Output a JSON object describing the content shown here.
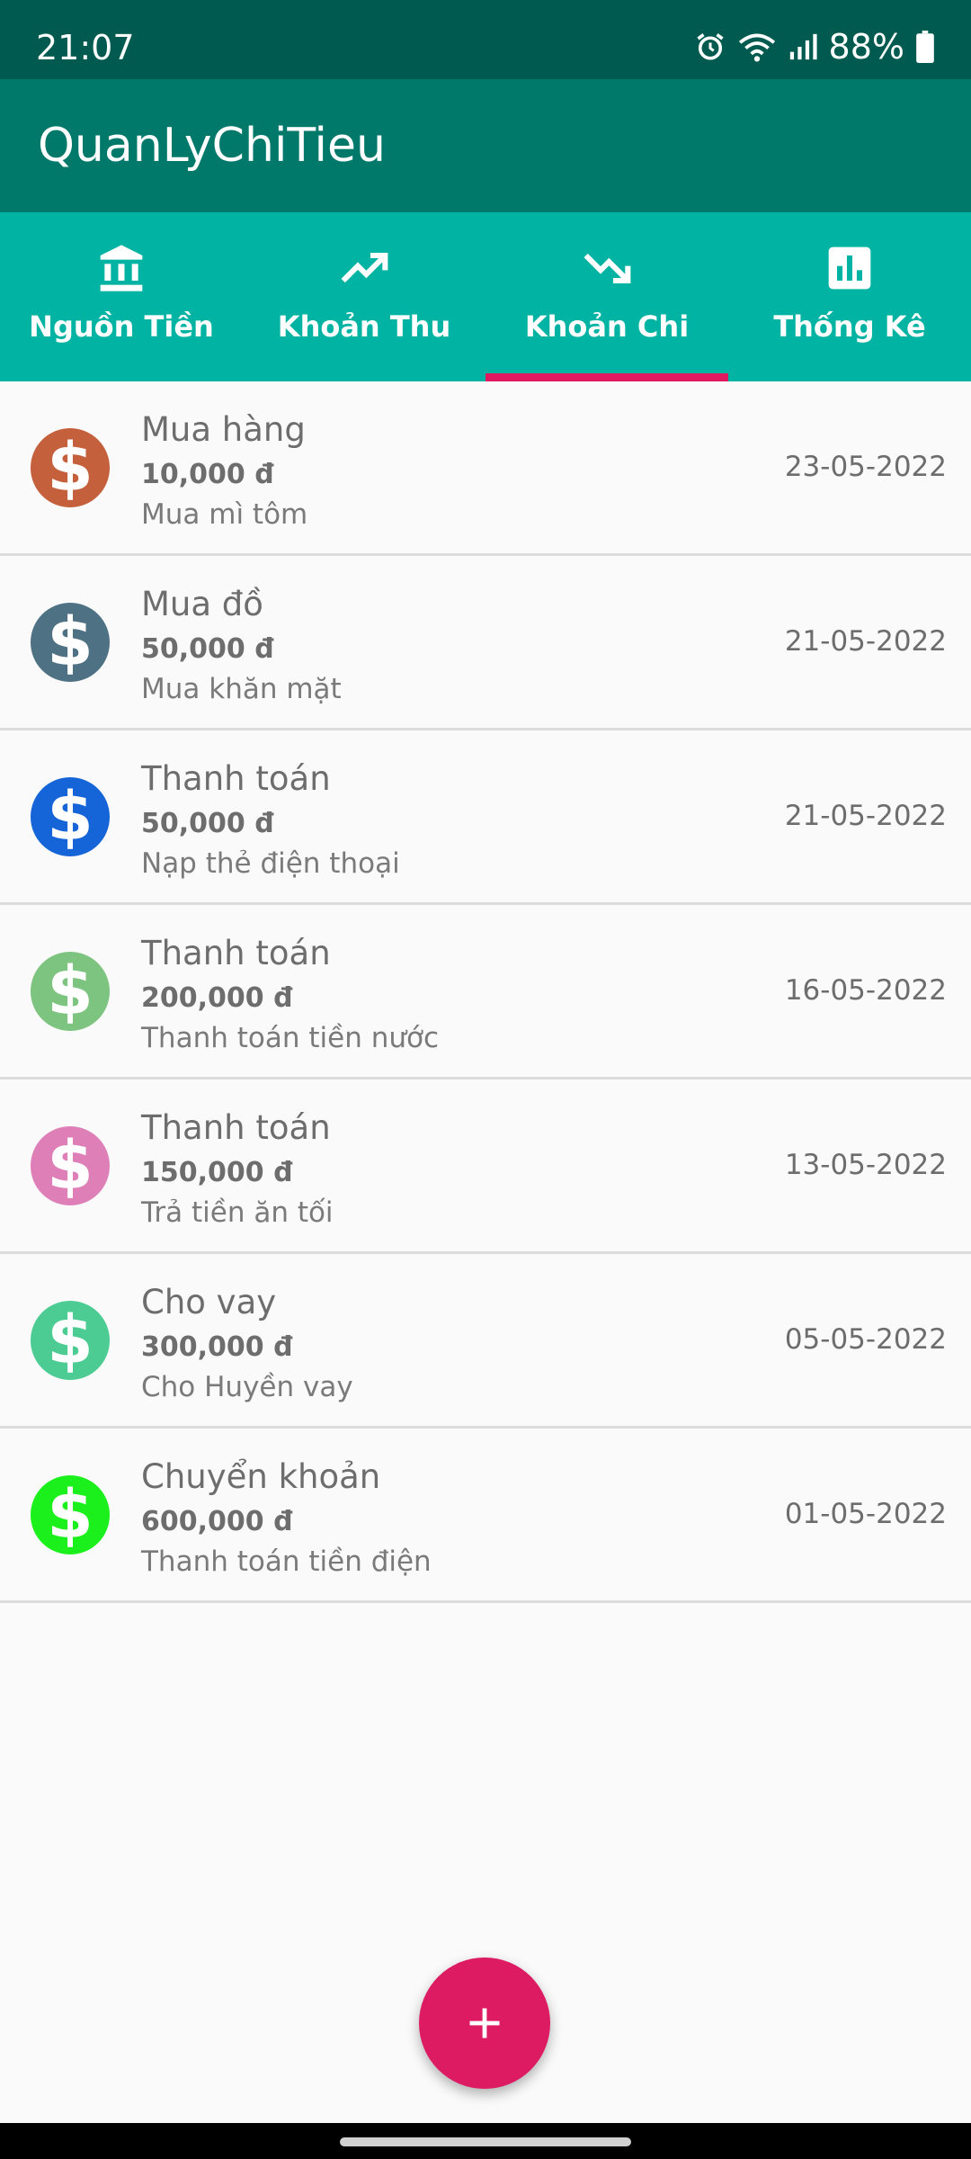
{
  "status_bar": {
    "time": "21:07",
    "battery": "88%"
  },
  "app_bar": {
    "title": "QuanLyChiTieu"
  },
  "tabs": [
    {
      "label": "Nguồn Tiền",
      "icon": "bank-icon"
    },
    {
      "label": "Khoản Thu",
      "icon": "trending-up-icon"
    },
    {
      "label": "Khoản Chi",
      "icon": "trending-down-icon",
      "selected": true
    },
    {
      "label": "Thống Kê",
      "icon": "bar-chart-icon"
    }
  ],
  "accent_color": "#e0185f",
  "items": [
    {
      "title": "Mua hàng",
      "amount": "10,000 đ",
      "note": "Mua mì tôm",
      "date": "23-05-2022",
      "icon_color": "#c4603b"
    },
    {
      "title": "Mua đồ",
      "amount": "50,000 đ",
      "note": "Mua khăn mặt",
      "date": "21-05-2022",
      "icon_color": "#4f7184"
    },
    {
      "title": "Thanh toán",
      "amount": "50,000 đ",
      "note": "Nạp thẻ điện thoại",
      "date": "21-05-2022",
      "icon_color": "#1565d8"
    },
    {
      "title": "Thanh toán",
      "amount": "200,000 đ",
      "note": "Thanh toán tiền nước",
      "date": "16-05-2022",
      "icon_color": "#7cc47f"
    },
    {
      "title": "Thanh toán",
      "amount": "150,000 đ",
      "note": "Trả tiền ăn tối",
      "date": "13-05-2022",
      "icon_color": "#de7fb8"
    },
    {
      "title": "Cho vay",
      "amount": "300,000 đ",
      "note": "Cho Huyền vay",
      "date": "05-05-2022",
      "icon_color": "#4ccc93"
    },
    {
      "title": "Chuyển khoản",
      "amount": "600,000 đ",
      "note": "Thanh toán tiền điện",
      "date": "01-05-2022",
      "icon_color": "#1cf01c"
    }
  ],
  "icons": {
    "item": "dollar-icon",
    "fab": "plus-icon"
  }
}
